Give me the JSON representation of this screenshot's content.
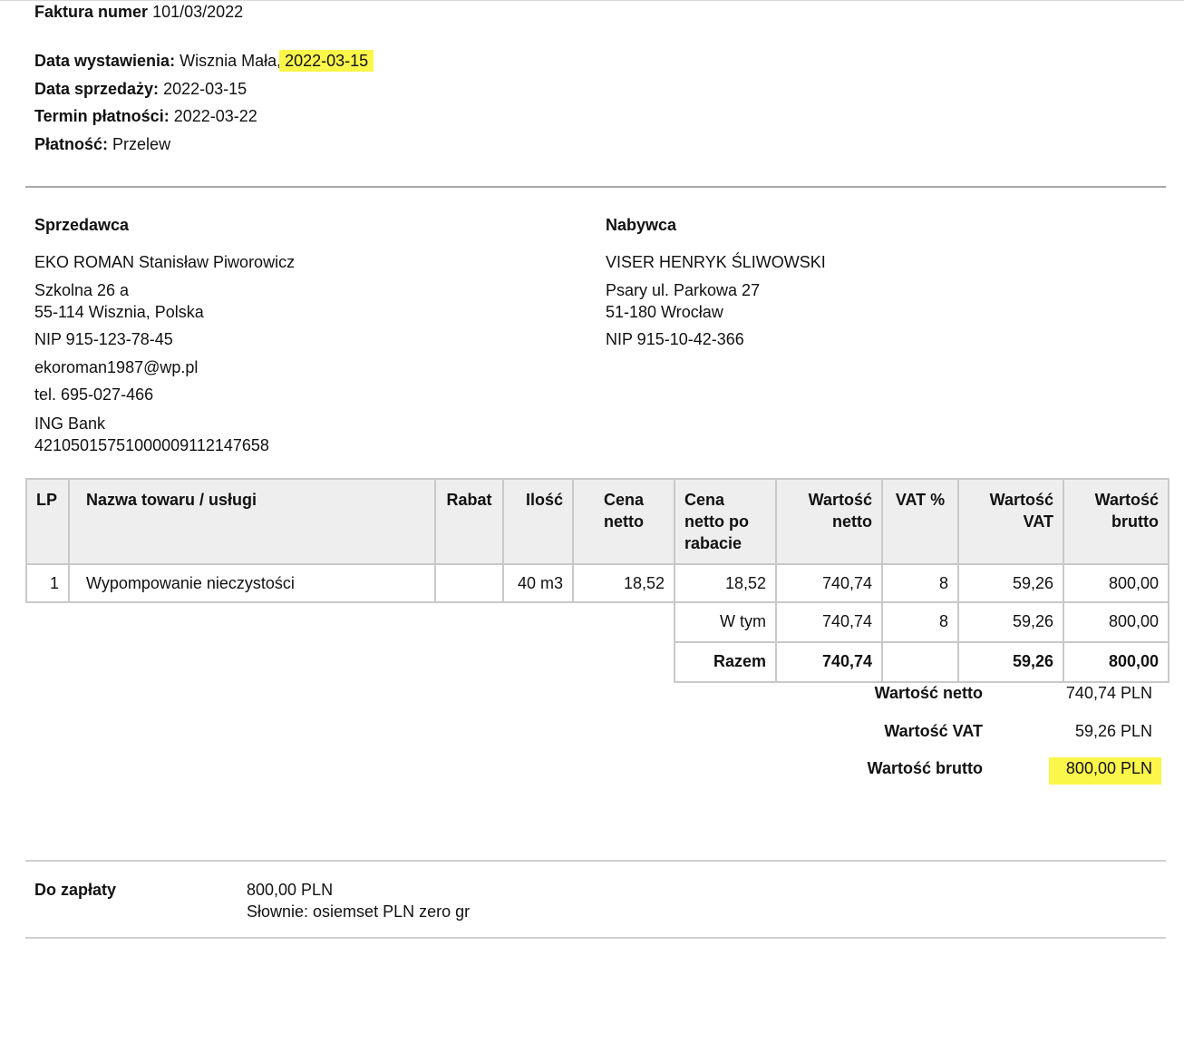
{
  "header": {
    "invoice_label": "Faktura numer",
    "invoice_number": "101/03/2022",
    "issue_label": "Data wystawienia:",
    "issue_place": "Wisznia Mała,",
    "issue_date": "2022-03-15",
    "sale_label": "Data sprzedaży:",
    "sale_date": "2022-03-15",
    "due_label": "Termin płatności:",
    "due_date": "2022-03-22",
    "payment_label": "Płatność:",
    "payment_method": "Przelew"
  },
  "seller": {
    "heading": "Sprzedawca",
    "name": "EKO ROMAN Stanisław Piworowicz",
    "street": "Szkolna 26 a",
    "city": "55-114 Wisznia, Polska",
    "nip": "NIP 915-123-78-45",
    "email": "ekoroman1987@wp.pl",
    "phone": "tel. 695-027-466",
    "bank": "ING Bank",
    "account": "42105015751000009112147658"
  },
  "buyer": {
    "heading": "Nabywca",
    "name": "VISER HENRYK ŚLIWOWSKI",
    "street": "Psary ul. Parkowa 27",
    "city": "51-180 Wrocław",
    "nip": "NIP 915-10-42-366"
  },
  "table": {
    "columns": [
      "LP",
      "Nazwa towaru / usługi",
      "Rabat",
      "Ilość",
      "Cena netto",
      "Cena netto po rabacie",
      "Wartość netto",
      "VAT %",
      "Wartość VAT",
      "Wartość brutto"
    ],
    "rows": [
      {
        "lp": "1",
        "name": "Wypompowanie nieczystości",
        "discount": "",
        "qty": "40 m3",
        "price": "18,52",
        "price_after": "18,52",
        "net": "740,74",
        "vat_rate": "8",
        "vat": "59,26",
        "gross": "800,00"
      }
    ],
    "subtotal": {
      "label": "W tym",
      "net": "740,74",
      "vat_rate": "8",
      "vat": "59,26",
      "gross": "800,00"
    },
    "total": {
      "label": "Razem",
      "net": "740,74",
      "vat_rate": "",
      "vat": "59,26",
      "gross": "800,00"
    }
  },
  "summary": {
    "net_label": "Wartość netto",
    "net_value": "740,74 PLN",
    "vat_label": "Wartość VAT",
    "vat_value": "59,26 PLN",
    "gross_label": "Wartość brutto",
    "gross_value": "800,00 PLN"
  },
  "payment": {
    "label": "Do zapłaty",
    "amount": "800,00 PLN",
    "in_words": "Słownie: osiemset PLN zero gr"
  },
  "colors": {
    "highlight": "#fbf64a",
    "header_bg": "#eeeeee",
    "border": "#c9c9c9"
  }
}
